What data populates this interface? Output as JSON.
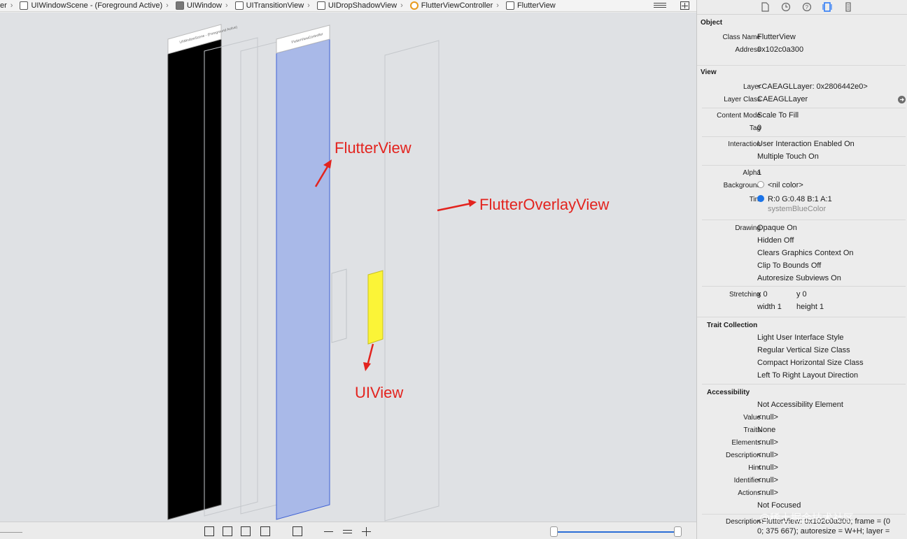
{
  "breadcrumb": {
    "items": [
      {
        "label": "er",
        "icon": "none"
      },
      {
        "label": "UIWindowScene - (Foreground Active)",
        "icon": "scene-icon"
      },
      {
        "label": "UIWindow",
        "icon": "window-icon"
      },
      {
        "label": "UITransitionView",
        "icon": "view-icon"
      },
      {
        "label": "UIDropShadowView",
        "icon": "view-icon"
      },
      {
        "label": "FlutterViewController",
        "icon": "view-controller-icon"
      },
      {
        "label": "FlutterView",
        "icon": "view-icon"
      }
    ]
  },
  "canvas": {
    "layer_header_1": "UIWindowScene - (Foreground Active)",
    "layer_header_2": "FlutterViewController",
    "annotations": {
      "flutter_view": "FlutterView",
      "flutter_overlay_view": "FlutterOverlayView",
      "ui_view": "UIView"
    },
    "colors": {
      "flutter_view_fill": "#a9b9e8",
      "uiview_fill": "#fbf437",
      "annotation": "#e3231e"
    }
  },
  "inspector": {
    "object": {
      "title": "Object",
      "class_name_label": "Class Name",
      "class_name": "FlutterView",
      "address_label": "Address",
      "address": "0x102c0a300"
    },
    "view": {
      "title": "View",
      "layer_label": "Layer",
      "layer": "<CAEAGLLayer: 0x2806442e0>",
      "layer_class_label": "Layer Class",
      "layer_class": "CAEAGLLayer",
      "content_mode_label": "Content Mode",
      "content_mode": "Scale To Fill",
      "tag_label": "Tag",
      "tag": "0",
      "interaction_label": "Interaction",
      "interaction_1": "User Interaction Enabled On",
      "interaction_2": "Multiple Touch On",
      "alpha_label": "Alpha",
      "alpha": "1",
      "background_label": "Background",
      "background": "<nil color>",
      "tint_label": "Tint",
      "tint": "R:0 G:0.48 B:1 A:1",
      "tint_name": "systemBlueColor",
      "tint_color": "#1a73e8",
      "drawing_label": "Drawing",
      "drawing": [
        "Opaque On",
        "Hidden Off",
        "Clears Graphics Context On",
        "Clip To Bounds Off",
        "Autoresize Subviews On"
      ],
      "stretching_label": "Stretching",
      "stretch_x": "x  0",
      "stretch_y": "y  0",
      "stretch_w": "width  1",
      "stretch_h": "height  1"
    },
    "traits": {
      "title": "Trait Collection",
      "items": [
        "Light User Interface Style",
        "Regular Vertical Size Class",
        "Compact Horizontal Size Class",
        "Left To Right Layout Direction"
      ]
    },
    "accessibility": {
      "title": "Accessibility",
      "not_element": "Not Accessibility Element",
      "rows": [
        {
          "label": "Value",
          "value": "<null>"
        },
        {
          "label": "Traits",
          "value": "None"
        },
        {
          "label": "Elements",
          "value": "<null>"
        },
        {
          "label": "Description",
          "value": "<null>"
        },
        {
          "label": "Hint",
          "value": "<null>"
        },
        {
          "label": "Identifier",
          "value": "<null>"
        },
        {
          "label": "Actions",
          "value": "<null>"
        }
      ],
      "focus": "Not Focused"
    },
    "description": {
      "label": "Description",
      "line1": "<FlutterView: 0x102c0a300; frame = (0",
      "line2": "0; 375 667); autoresize = W+H; layer ="
    }
  },
  "watermark": "@稀土掘金技术社区"
}
